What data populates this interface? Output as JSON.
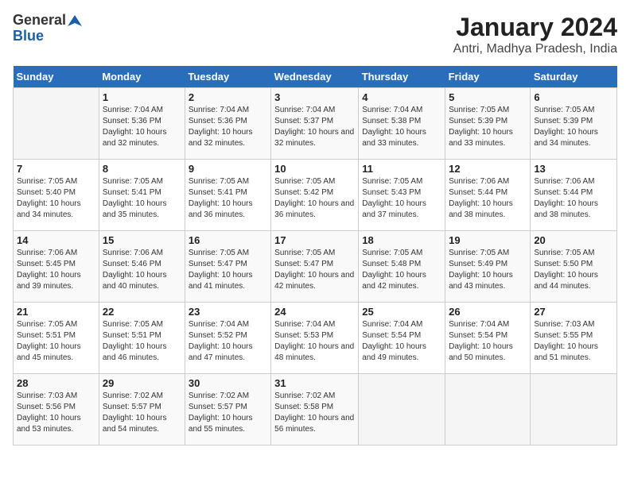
{
  "logo": {
    "general": "General",
    "blue": "Blue"
  },
  "title": "January 2024",
  "subtitle": "Antri, Madhya Pradesh, India",
  "days_of_week": [
    "Sunday",
    "Monday",
    "Tuesday",
    "Wednesday",
    "Thursday",
    "Friday",
    "Saturday"
  ],
  "weeks": [
    [
      {
        "num": "",
        "sunrise": "",
        "sunset": "",
        "daylight": ""
      },
      {
        "num": "1",
        "sunrise": "Sunrise: 7:04 AM",
        "sunset": "Sunset: 5:36 PM",
        "daylight": "Daylight: 10 hours and 32 minutes."
      },
      {
        "num": "2",
        "sunrise": "Sunrise: 7:04 AM",
        "sunset": "Sunset: 5:36 PM",
        "daylight": "Daylight: 10 hours and 32 minutes."
      },
      {
        "num": "3",
        "sunrise": "Sunrise: 7:04 AM",
        "sunset": "Sunset: 5:37 PM",
        "daylight": "Daylight: 10 hours and 32 minutes."
      },
      {
        "num": "4",
        "sunrise": "Sunrise: 7:04 AM",
        "sunset": "Sunset: 5:38 PM",
        "daylight": "Daylight: 10 hours and 33 minutes."
      },
      {
        "num": "5",
        "sunrise": "Sunrise: 7:05 AM",
        "sunset": "Sunset: 5:39 PM",
        "daylight": "Daylight: 10 hours and 33 minutes."
      },
      {
        "num": "6",
        "sunrise": "Sunrise: 7:05 AM",
        "sunset": "Sunset: 5:39 PM",
        "daylight": "Daylight: 10 hours and 34 minutes."
      }
    ],
    [
      {
        "num": "7",
        "sunrise": "Sunrise: 7:05 AM",
        "sunset": "Sunset: 5:40 PM",
        "daylight": "Daylight: 10 hours and 34 minutes."
      },
      {
        "num": "8",
        "sunrise": "Sunrise: 7:05 AM",
        "sunset": "Sunset: 5:41 PM",
        "daylight": "Daylight: 10 hours and 35 minutes."
      },
      {
        "num": "9",
        "sunrise": "Sunrise: 7:05 AM",
        "sunset": "Sunset: 5:41 PM",
        "daylight": "Daylight: 10 hours and 36 minutes."
      },
      {
        "num": "10",
        "sunrise": "Sunrise: 7:05 AM",
        "sunset": "Sunset: 5:42 PM",
        "daylight": "Daylight: 10 hours and 36 minutes."
      },
      {
        "num": "11",
        "sunrise": "Sunrise: 7:05 AM",
        "sunset": "Sunset: 5:43 PM",
        "daylight": "Daylight: 10 hours and 37 minutes."
      },
      {
        "num": "12",
        "sunrise": "Sunrise: 7:06 AM",
        "sunset": "Sunset: 5:44 PM",
        "daylight": "Daylight: 10 hours and 38 minutes."
      },
      {
        "num": "13",
        "sunrise": "Sunrise: 7:06 AM",
        "sunset": "Sunset: 5:44 PM",
        "daylight": "Daylight: 10 hours and 38 minutes."
      }
    ],
    [
      {
        "num": "14",
        "sunrise": "Sunrise: 7:06 AM",
        "sunset": "Sunset: 5:45 PM",
        "daylight": "Daylight: 10 hours and 39 minutes."
      },
      {
        "num": "15",
        "sunrise": "Sunrise: 7:06 AM",
        "sunset": "Sunset: 5:46 PM",
        "daylight": "Daylight: 10 hours and 40 minutes."
      },
      {
        "num": "16",
        "sunrise": "Sunrise: 7:05 AM",
        "sunset": "Sunset: 5:47 PM",
        "daylight": "Daylight: 10 hours and 41 minutes."
      },
      {
        "num": "17",
        "sunrise": "Sunrise: 7:05 AM",
        "sunset": "Sunset: 5:47 PM",
        "daylight": "Daylight: 10 hours and 42 minutes."
      },
      {
        "num": "18",
        "sunrise": "Sunrise: 7:05 AM",
        "sunset": "Sunset: 5:48 PM",
        "daylight": "Daylight: 10 hours and 42 minutes."
      },
      {
        "num": "19",
        "sunrise": "Sunrise: 7:05 AM",
        "sunset": "Sunset: 5:49 PM",
        "daylight": "Daylight: 10 hours and 43 minutes."
      },
      {
        "num": "20",
        "sunrise": "Sunrise: 7:05 AM",
        "sunset": "Sunset: 5:50 PM",
        "daylight": "Daylight: 10 hours and 44 minutes."
      }
    ],
    [
      {
        "num": "21",
        "sunrise": "Sunrise: 7:05 AM",
        "sunset": "Sunset: 5:51 PM",
        "daylight": "Daylight: 10 hours and 45 minutes."
      },
      {
        "num": "22",
        "sunrise": "Sunrise: 7:05 AM",
        "sunset": "Sunset: 5:51 PM",
        "daylight": "Daylight: 10 hours and 46 minutes."
      },
      {
        "num": "23",
        "sunrise": "Sunrise: 7:04 AM",
        "sunset": "Sunset: 5:52 PM",
        "daylight": "Daylight: 10 hours and 47 minutes."
      },
      {
        "num": "24",
        "sunrise": "Sunrise: 7:04 AM",
        "sunset": "Sunset: 5:53 PM",
        "daylight": "Daylight: 10 hours and 48 minutes."
      },
      {
        "num": "25",
        "sunrise": "Sunrise: 7:04 AM",
        "sunset": "Sunset: 5:54 PM",
        "daylight": "Daylight: 10 hours and 49 minutes."
      },
      {
        "num": "26",
        "sunrise": "Sunrise: 7:04 AM",
        "sunset": "Sunset: 5:54 PM",
        "daylight": "Daylight: 10 hours and 50 minutes."
      },
      {
        "num": "27",
        "sunrise": "Sunrise: 7:03 AM",
        "sunset": "Sunset: 5:55 PM",
        "daylight": "Daylight: 10 hours and 51 minutes."
      }
    ],
    [
      {
        "num": "28",
        "sunrise": "Sunrise: 7:03 AM",
        "sunset": "Sunset: 5:56 PM",
        "daylight": "Daylight: 10 hours and 53 minutes."
      },
      {
        "num": "29",
        "sunrise": "Sunrise: 7:02 AM",
        "sunset": "Sunset: 5:57 PM",
        "daylight": "Daylight: 10 hours and 54 minutes."
      },
      {
        "num": "30",
        "sunrise": "Sunrise: 7:02 AM",
        "sunset": "Sunset: 5:57 PM",
        "daylight": "Daylight: 10 hours and 55 minutes."
      },
      {
        "num": "31",
        "sunrise": "Sunrise: 7:02 AM",
        "sunset": "Sunset: 5:58 PM",
        "daylight": "Daylight: 10 hours and 56 minutes."
      },
      {
        "num": "",
        "sunrise": "",
        "sunset": "",
        "daylight": ""
      },
      {
        "num": "",
        "sunrise": "",
        "sunset": "",
        "daylight": ""
      },
      {
        "num": "",
        "sunrise": "",
        "sunset": "",
        "daylight": ""
      }
    ]
  ]
}
